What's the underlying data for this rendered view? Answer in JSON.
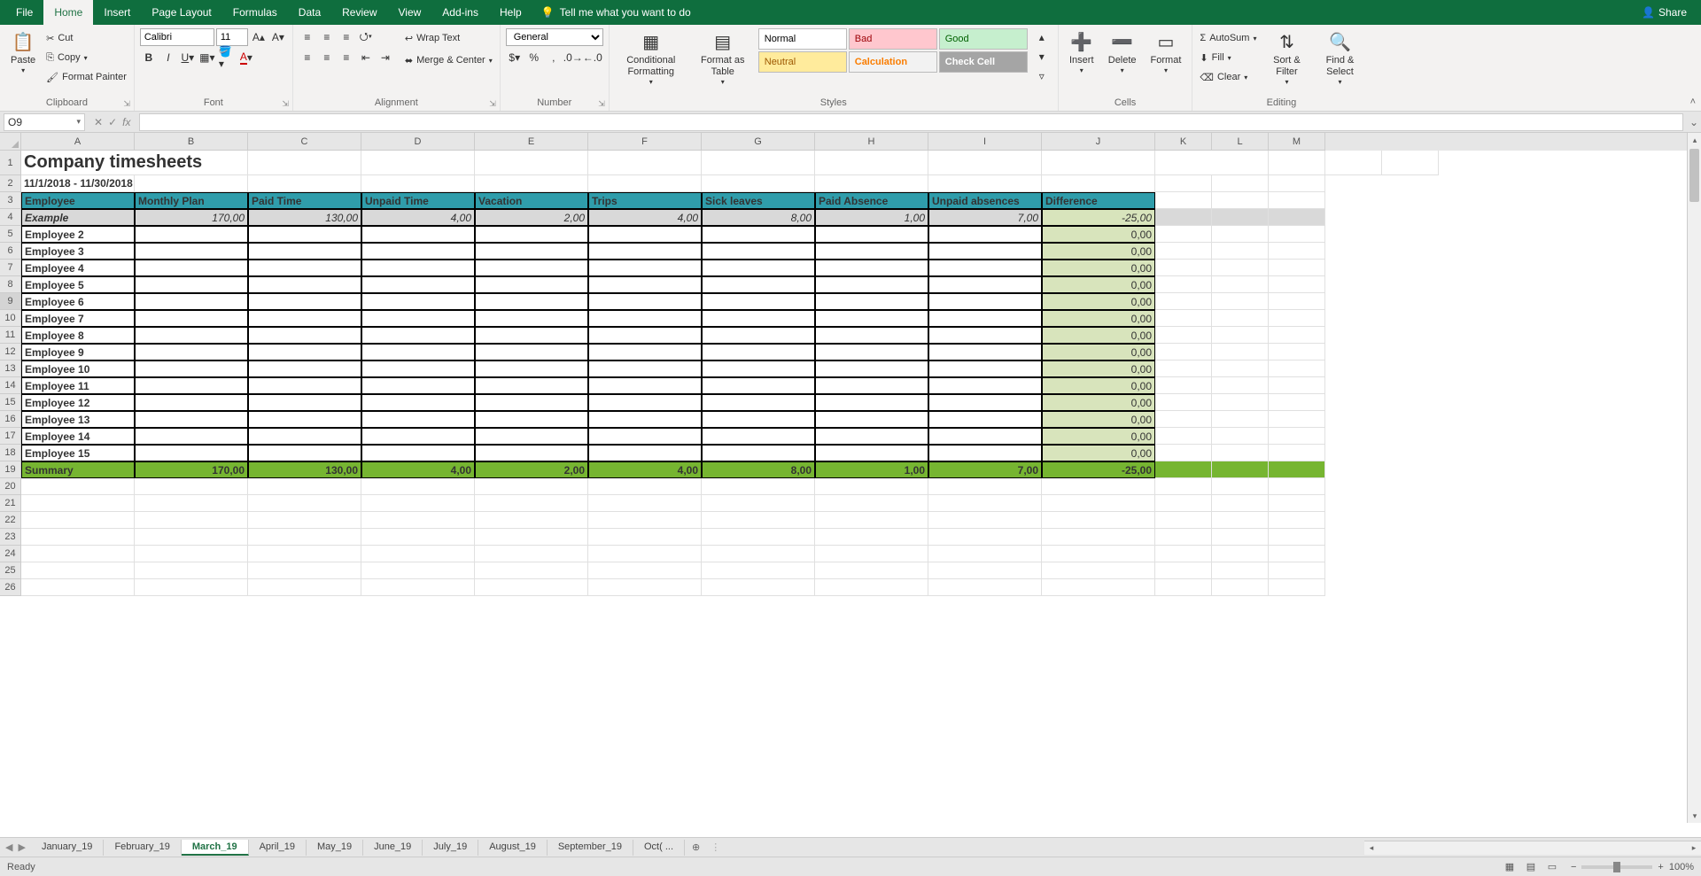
{
  "menu": {
    "tabs": [
      "File",
      "Home",
      "Insert",
      "Page Layout",
      "Formulas",
      "Data",
      "Review",
      "View",
      "Add-ins",
      "Help"
    ],
    "active": "Home",
    "tell": "Tell me what you want to do",
    "share": "Share"
  },
  "ribbon": {
    "clipboard": {
      "paste": "Paste",
      "cut": "Cut",
      "copy": "Copy",
      "formatPainter": "Format Painter",
      "label": "Clipboard"
    },
    "font": {
      "name": "Calibri",
      "size": "11",
      "label": "Font"
    },
    "alignment": {
      "wrap": "Wrap Text",
      "merge": "Merge & Center",
      "label": "Alignment"
    },
    "number": {
      "format": "General",
      "label": "Number"
    },
    "styles": {
      "cond": "Conditional Formatting",
      "fmtTable": "Format as Table",
      "cells": [
        {
          "t": "Normal",
          "bg": "#ffffff",
          "fg": "#000"
        },
        {
          "t": "Bad",
          "bg": "#ffc7ce",
          "fg": "#9c0006"
        },
        {
          "t": "Good",
          "bg": "#c6efce",
          "fg": "#006100"
        },
        {
          "t": "Neutral",
          "bg": "#ffeb9c",
          "fg": "#9c5700"
        },
        {
          "t": "Calculation",
          "bg": "#f2f2f2",
          "fg": "#fa7d00"
        },
        {
          "t": "Check Cell",
          "bg": "#a5a5a5",
          "fg": "#ffffff"
        }
      ],
      "label": "Styles"
    },
    "cells": {
      "insert": "Insert",
      "delete": "Delete",
      "format": "Format",
      "label": "Cells"
    },
    "editing": {
      "autosum": "AutoSum",
      "fill": "Fill",
      "clear": "Clear",
      "sort": "Sort & Filter",
      "find": "Find & Select",
      "label": "Editing"
    }
  },
  "namebox": "O9",
  "sheet": {
    "cols": [
      "A",
      "B",
      "C",
      "D",
      "E",
      "F",
      "G",
      "H",
      "I",
      "J",
      "K",
      "L",
      "M"
    ],
    "title": "Company timesheets",
    "dateRange": "11/1/2018 - 11/30/2018",
    "headers": [
      "Employee",
      "Monthly Plan",
      "Paid Time",
      "Unpaid Time",
      "Vacation",
      "Trips",
      "Sick leaves",
      "Paid Absence",
      "Unpaid absences",
      "Difference"
    ],
    "rows": [
      {
        "n": 4,
        "label": "Example",
        "vals": [
          "170,00",
          "130,00",
          "4,00",
          "2,00",
          "4,00",
          "8,00",
          "1,00",
          "7,00",
          "-25,00"
        ],
        "cls": "ex-row"
      },
      {
        "n": 5,
        "label": "Employee 2",
        "vals": [
          "",
          "",
          "",
          "",
          "",
          "",
          "",
          "",
          "0,00"
        ]
      },
      {
        "n": 6,
        "label": "Employee 3",
        "vals": [
          "",
          "",
          "",
          "",
          "",
          "",
          "",
          "",
          "0,00"
        ]
      },
      {
        "n": 7,
        "label": "Employee 4",
        "vals": [
          "",
          "",
          "",
          "",
          "",
          "",
          "",
          "",
          "0,00"
        ]
      },
      {
        "n": 8,
        "label": "Employee 5",
        "vals": [
          "",
          "",
          "",
          "",
          "",
          "",
          "",
          "",
          "0,00"
        ]
      },
      {
        "n": 9,
        "label": "Employee 6",
        "vals": [
          "",
          "",
          "",
          "",
          "",
          "",
          "",
          "",
          "0,00"
        ]
      },
      {
        "n": 10,
        "label": "Employee 7",
        "vals": [
          "",
          "",
          "",
          "",
          "",
          "",
          "",
          "",
          "0,00"
        ]
      },
      {
        "n": 11,
        "label": "Employee 8",
        "vals": [
          "",
          "",
          "",
          "",
          "",
          "",
          "",
          "",
          "0,00"
        ]
      },
      {
        "n": 12,
        "label": "Employee 9",
        "vals": [
          "",
          "",
          "",
          "",
          "",
          "",
          "",
          "",
          "0,00"
        ]
      },
      {
        "n": 13,
        "label": "Employee 10",
        "vals": [
          "",
          "",
          "",
          "",
          "",
          "",
          "",
          "",
          "0,00"
        ]
      },
      {
        "n": 14,
        "label": "Employee 11",
        "vals": [
          "",
          "",
          "",
          "",
          "",
          "",
          "",
          "",
          "0,00"
        ]
      },
      {
        "n": 15,
        "label": "Employee 12",
        "vals": [
          "",
          "",
          "",
          "",
          "",
          "",
          "",
          "",
          "0,00"
        ]
      },
      {
        "n": 16,
        "label": "Employee 13",
        "vals": [
          "",
          "",
          "",
          "",
          "",
          "",
          "",
          "",
          "0,00"
        ]
      },
      {
        "n": 17,
        "label": "Employee 14",
        "vals": [
          "",
          "",
          "",
          "",
          "",
          "",
          "",
          "",
          "0,00"
        ]
      },
      {
        "n": 18,
        "label": "Employee 15",
        "vals": [
          "",
          "",
          "",
          "",
          "",
          "",
          "",
          "",
          "0,00"
        ]
      },
      {
        "n": 19,
        "label": "Summary",
        "vals": [
          "170,00",
          "130,00",
          "4,00",
          "2,00",
          "4,00",
          "8,00",
          "1,00",
          "7,00",
          "-25,00"
        ],
        "cls": "sum-row"
      }
    ],
    "emptyRows": [
      20,
      21,
      22,
      23,
      24,
      25,
      26
    ]
  },
  "tabs": {
    "list": [
      "January_19",
      "February_19",
      "March_19",
      "April_19",
      "May_19",
      "June_19",
      "July_19",
      "August_19",
      "September_19",
      "Oct( ..."
    ],
    "active": "March_19"
  },
  "status": {
    "ready": "Ready",
    "zoom": "100%"
  }
}
